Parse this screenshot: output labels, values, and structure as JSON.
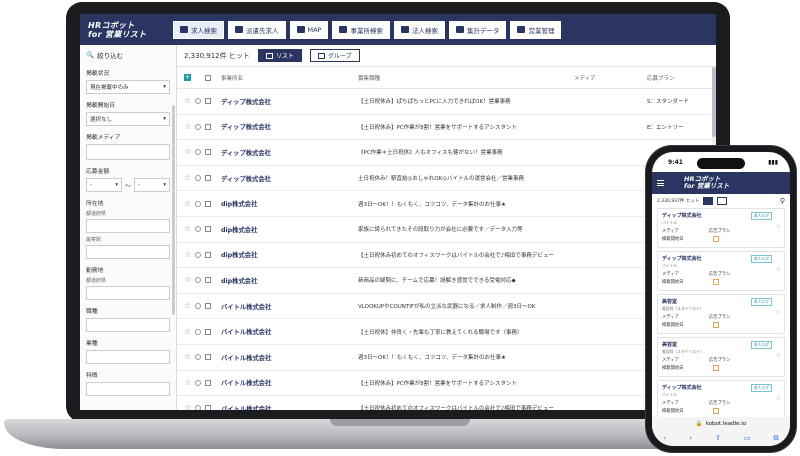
{
  "laptop": {
    "logo_line1": "HRコボット",
    "logo_line2": "for 営業リスト",
    "nav_tabs": [
      "求人検索",
      "派遣先求人",
      "MAP",
      "事業所検索",
      "法人検索",
      "集計データ",
      "営業管理"
    ],
    "active_tab": 0,
    "sidebar": {
      "title": "絞り込む",
      "f_status_label": "掲載状況",
      "f_status_value": "現在掲載中のみ",
      "f_date_label": "掲載開始日",
      "f_date_value": "選択なし",
      "f_media_label": "掲載メディア",
      "f_salary_label": "応募金額",
      "f_salary_from": "-",
      "f_salary_to": "-",
      "f_range_sep": "〜",
      "f_location_label": "所在地",
      "f_location_sub": "都道府県",
      "f_station_sub": "最寄駅",
      "f_work_label": "勤務地",
      "f_work_sub": "都道府県",
      "f_job_label": "職種",
      "f_industry_label": "業種",
      "f_feature_label": "特徴"
    },
    "toolbar": {
      "hits": "2,330,912件 ヒット",
      "list_label": "リスト",
      "group_label": "グループ"
    },
    "table": {
      "headers": [
        "事業所名",
        "募集職種",
        "メディア",
        "応募プラン"
      ],
      "rows": [
        {
          "name": "ディップ株式会社",
          "title": "【土日祝休み】ぱちぱちっとPCに入力できればOK！営業事務",
          "plan": "S：スタンダード"
        },
        {
          "name": "ディップ株式会社",
          "title": "【土日祝休み】PC作業が8割！営業をサポートするアシスタント",
          "plan": "E：エントリー"
        },
        {
          "name": "ディップ株式会社",
          "title": "《PC作業＊土日祝休》人もオフィスも健がない！営業事務",
          "plan": ""
        },
        {
          "name": "ディップ株式会社",
          "title": "土日祝休み！駅直結◎おしゃれOK◎バイトルの運営会社／営業事務",
          "plan": ""
        },
        {
          "name": "dip株式会社",
          "title": "週3日〜OK！！もくもく、コツコツ、データ集計のお仕事★",
          "plan": ""
        },
        {
          "name": "dip株式会社",
          "title": "家族に誇られてきたその段取り力が会社に必要です／データ入力等",
          "plan": ""
        },
        {
          "name": "dip株式会社",
          "title": "【土日祝休み初めてのオフィスワークはバイトルの会社で♪梅田で事務デビュー",
          "plan": ""
        },
        {
          "name": "dip株式会社",
          "title": "新商品の疑問に、チームで応募！謎解き感覚でできる受電対応◆",
          "plan": ""
        },
        {
          "name": "バイトル株式会社",
          "title": "VLOOKUPやCOUNTIFが私の立派な武器になる／求人制作／週3日〜OK",
          "plan": ""
        },
        {
          "name": "バイトル株式会社",
          "title": "【土日祝休】仲良く・先輩も丁寧に教えてくれる職場です（事務）",
          "plan": ""
        },
        {
          "name": "バイトル株式会社",
          "title": "週3日〜OK！！もくもく、コツコツ、データ集計のお仕事★",
          "plan": ""
        },
        {
          "name": "バイトル株式会社",
          "title": "【土日祝休み】PC作業が8割！営業をサポートするアシスタント",
          "plan": ""
        },
        {
          "name": "バイトル株式会社",
          "title": "【土日祝休み初めてのオフィスワークはバイトルの会社で♪梅田で事務デビュー",
          "plan": ""
        }
      ]
    }
  },
  "phone": {
    "time": "9:41",
    "logo_line1": "HRコボット",
    "logo_line2": "for 営業リスト",
    "hits": "2,330,937件 ヒット",
    "media_label": "メディア",
    "date_label": "掲載開始日",
    "plan_label": "広告プラン",
    "badge": "求人ログ",
    "cards": [
      {
        "name": "ディップ株式会社",
        "sub": "バイトル"
      },
      {
        "name": "ディップ株式会社",
        "sub": "バイトル"
      },
      {
        "name": "美容室",
        "sub": "美容師（スタイリスト）"
      },
      {
        "name": "美容室",
        "sub": "美容師（スタイリスト）"
      },
      {
        "name": "ディップ株式会社",
        "sub": "バイトル"
      }
    ],
    "url": "kobot.leadle.io",
    "bottom_icons": [
      "‹",
      "›",
      "⇪",
      "▭",
      "⧉"
    ]
  }
}
